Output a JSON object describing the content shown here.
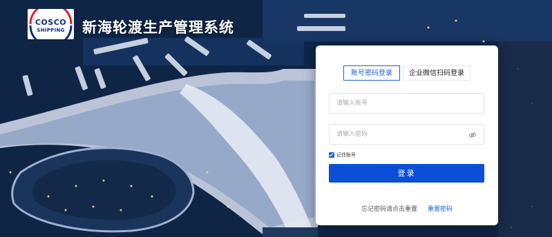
{
  "brand": {
    "logo_top": "COSCO",
    "logo_bottom": "SHIPPING",
    "system_title": "新海轮渡生产管理系统"
  },
  "login": {
    "tabs": [
      {
        "label": "账号密码登录",
        "active": true
      },
      {
        "label": "企业微信扫码登录",
        "active": false
      }
    ],
    "username_placeholder": "请输入账号",
    "password_placeholder": "请输入密码",
    "remember_label": "记住账号",
    "remember_checked": true,
    "submit_label": "登录",
    "forgot_text": "忘记密码请点击重置",
    "reset_link": "重置密码"
  },
  "colors": {
    "accent": "#1e5fd6",
    "button": "#0a4fd6",
    "background": "#0f2546"
  }
}
